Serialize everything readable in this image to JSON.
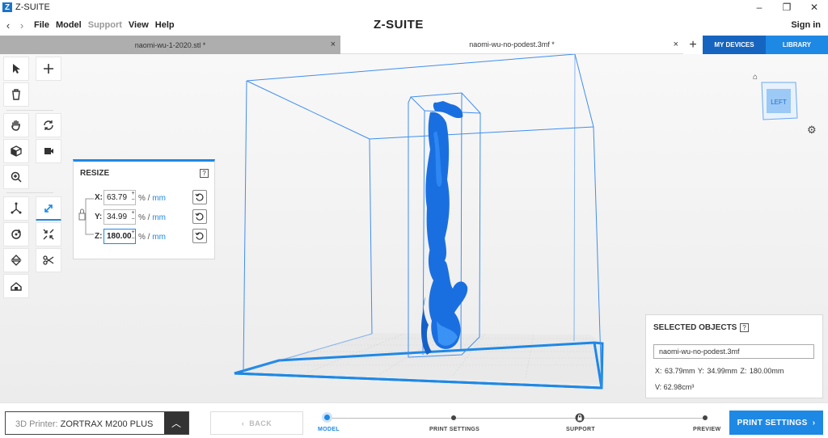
{
  "window": {
    "title": "Z-SUITE",
    "logo_letter": "Z",
    "controls": [
      "–",
      "❐",
      "✕"
    ]
  },
  "menu": {
    "items": [
      {
        "label": "File",
        "enabled": true
      },
      {
        "label": "Model",
        "enabled": true
      },
      {
        "label": "Support",
        "enabled": false
      },
      {
        "label": "View",
        "enabled": true
      },
      {
        "label": "Help",
        "enabled": true
      }
    ],
    "brand": "Z-SUITE",
    "signin": "Sign in"
  },
  "tabs": {
    "items": [
      {
        "label": "naomi-wu-1-2020.stl *",
        "active": false
      },
      {
        "label": "naomi-wu-no-podest.3mf *",
        "active": true
      }
    ],
    "add": "+",
    "close": "×",
    "my_devices": "MY DEVICES",
    "library": "LIBRARY"
  },
  "toolbar": {
    "tools": [
      "select-tool",
      "add-tool",
      "delete-tool",
      "pan-tool",
      "orbit-tool",
      "view-object-tool",
      "camera-tool",
      "zoom-tool",
      "move-tool",
      "resize-tool",
      "rotate-tool",
      "auto-scale-tool",
      "mirror-tool",
      "cut-tool",
      "place-on-bed-tool"
    ],
    "active_tool": "resize-tool"
  },
  "resize": {
    "title": "RESIZE",
    "help": "?",
    "unit_pct": "%",
    "unit_sep": " / ",
    "unit_mm": "mm",
    "rows": [
      {
        "axis": "X:",
        "value": "63.79",
        "focused": false
      },
      {
        "axis": "Y:",
        "value": "34.99",
        "focused": false
      },
      {
        "axis": "Z:",
        "value": "180.00",
        "focused": true
      }
    ]
  },
  "viewcube": {
    "face": "LEFT"
  },
  "selected_objects": {
    "title": "SELECTED OBJECTS",
    "help": "?",
    "name": "naomi-wu-no-podest.3mf",
    "dims": "X: 63.79mm  Y: 34.99mm  Z: 180.00mm",
    "volume": "V: 62.98cm³"
  },
  "bottom": {
    "printer_prefix": "3D Printer: ",
    "printer_name": "ZORTRAX M200 PLUS",
    "back": "BACK",
    "steps": [
      "MODEL",
      "PRINT SETTINGS",
      "SUPPORT",
      "PREVIEW"
    ],
    "current_step": "MODEL",
    "print_settings_button": "PRINT SETTINGS"
  },
  "colors": {
    "accent": "#1e88e5",
    "accent_dark": "#1565c0",
    "model": "#1a6fe0",
    "wireframe": "#3f8ef0"
  }
}
